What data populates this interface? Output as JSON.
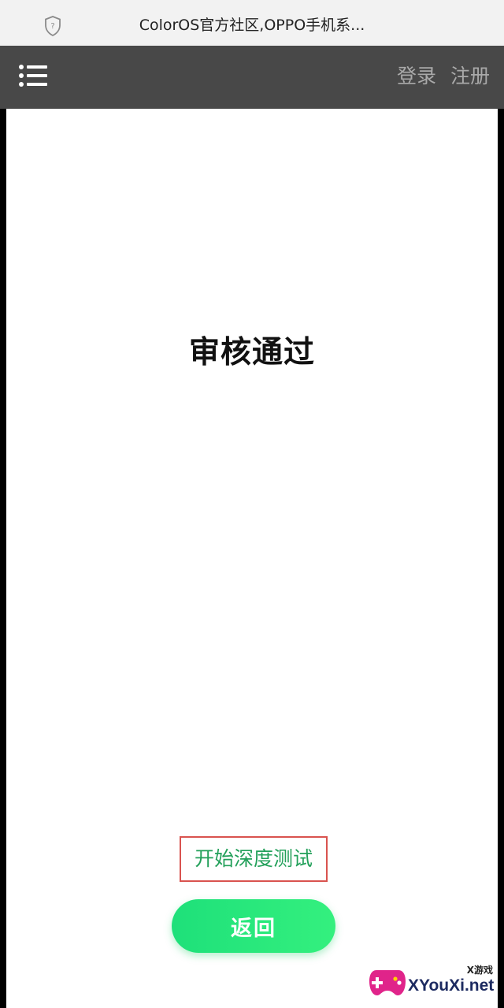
{
  "browser": {
    "page_title": "ColorOS官方社区,OPPO手机系..."
  },
  "header": {
    "login_label": "登录",
    "register_label": "注册"
  },
  "main": {
    "status_title": "审核通过",
    "deep_test_label": "开始深度测试",
    "back_label": "返回"
  },
  "watermark": {
    "cn_text": "X游戏",
    "domain": "XYouXi.net"
  },
  "colors": {
    "header_bg": "#484848",
    "accent_green": "#23a05a",
    "button_green": "#1ee07a",
    "highlight_red": "#d9534f"
  }
}
